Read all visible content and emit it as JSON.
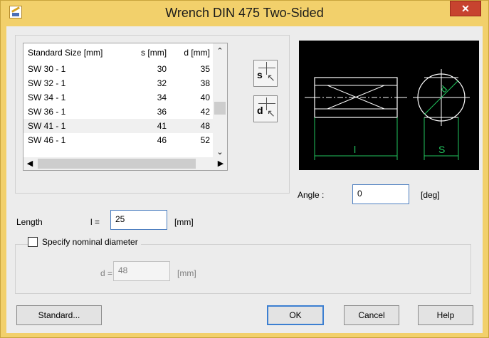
{
  "window": {
    "title": "Wrench DIN 475  Two-Sided",
    "close_label": "✕"
  },
  "sizes_table": {
    "columns": [
      "Standard Size [mm]",
      "s [mm]",
      "d [mm]"
    ],
    "rows": [
      {
        "size": "SW 30 - 1",
        "s": "30",
        "d": "35"
      },
      {
        "size": "SW 32 - 1",
        "s": "32",
        "d": "38"
      },
      {
        "size": "SW 34 - 1",
        "s": "34",
        "d": "40"
      },
      {
        "size": "SW 36 - 1",
        "s": "36",
        "d": "42"
      },
      {
        "size": "SW 41 - 1",
        "s": "41",
        "d": "48"
      },
      {
        "size": "SW 46 - 1",
        "s": "46",
        "d": "52"
      }
    ],
    "selected_row": 4
  },
  "pick_buttons": {
    "s_label": "s",
    "d_label": "d"
  },
  "preview": {
    "l_label": "l",
    "s_label": "S",
    "d_label": "d"
  },
  "angle": {
    "label": "Angle :",
    "value": "0",
    "unit": "[deg]"
  },
  "length": {
    "label": "Length",
    "symbol": "l =",
    "value": "25",
    "unit": "[mm]"
  },
  "nominal": {
    "checkbox_label": "Specify nominal diameter",
    "checked": false,
    "symbol": "d =",
    "value": "48",
    "unit": "[mm]"
  },
  "buttons": {
    "standard": "Standard...",
    "ok": "OK",
    "cancel": "Cancel",
    "help": "Help"
  },
  "colors": {
    "titlebar": "#f2d06b",
    "close": "#c7432f",
    "preview_bg": "#000000",
    "preview_lines": "#ffffff",
    "dimension_lines": "#22c55e"
  }
}
